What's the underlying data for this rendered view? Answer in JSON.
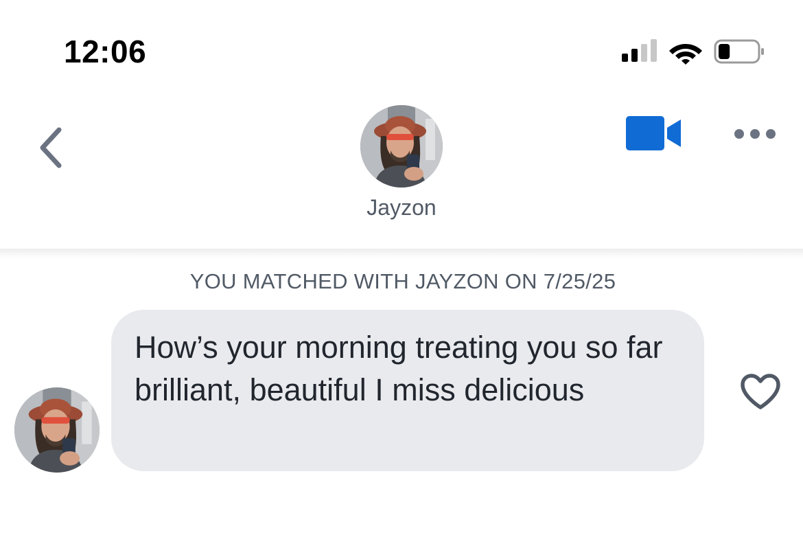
{
  "status_bar": {
    "time": "12:06",
    "signal_icon": "cellular-signal-icon",
    "wifi_icon": "wifi-icon",
    "battery_icon": "battery-icon",
    "battery_level": 0.3
  },
  "header": {
    "back_icon": "chevron-left-icon",
    "contact_name": "Jayzon",
    "video_icon": "video-camera-icon",
    "more_icon": "more-dots-icon"
  },
  "conversation": {
    "match_banner": "YOU MATCHED WITH JAYZON ON 7/25/25",
    "messages": [
      {
        "text": "How’s your morning treating you so far brilliant, beautiful I miss delicious",
        "like_icon": "heart-outline-icon"
      }
    ]
  },
  "colors": {
    "accent": "#106bd5",
    "bubble": "#e9eaee",
    "secondary_text": "#505965",
    "back_icon": "#6b7382"
  }
}
